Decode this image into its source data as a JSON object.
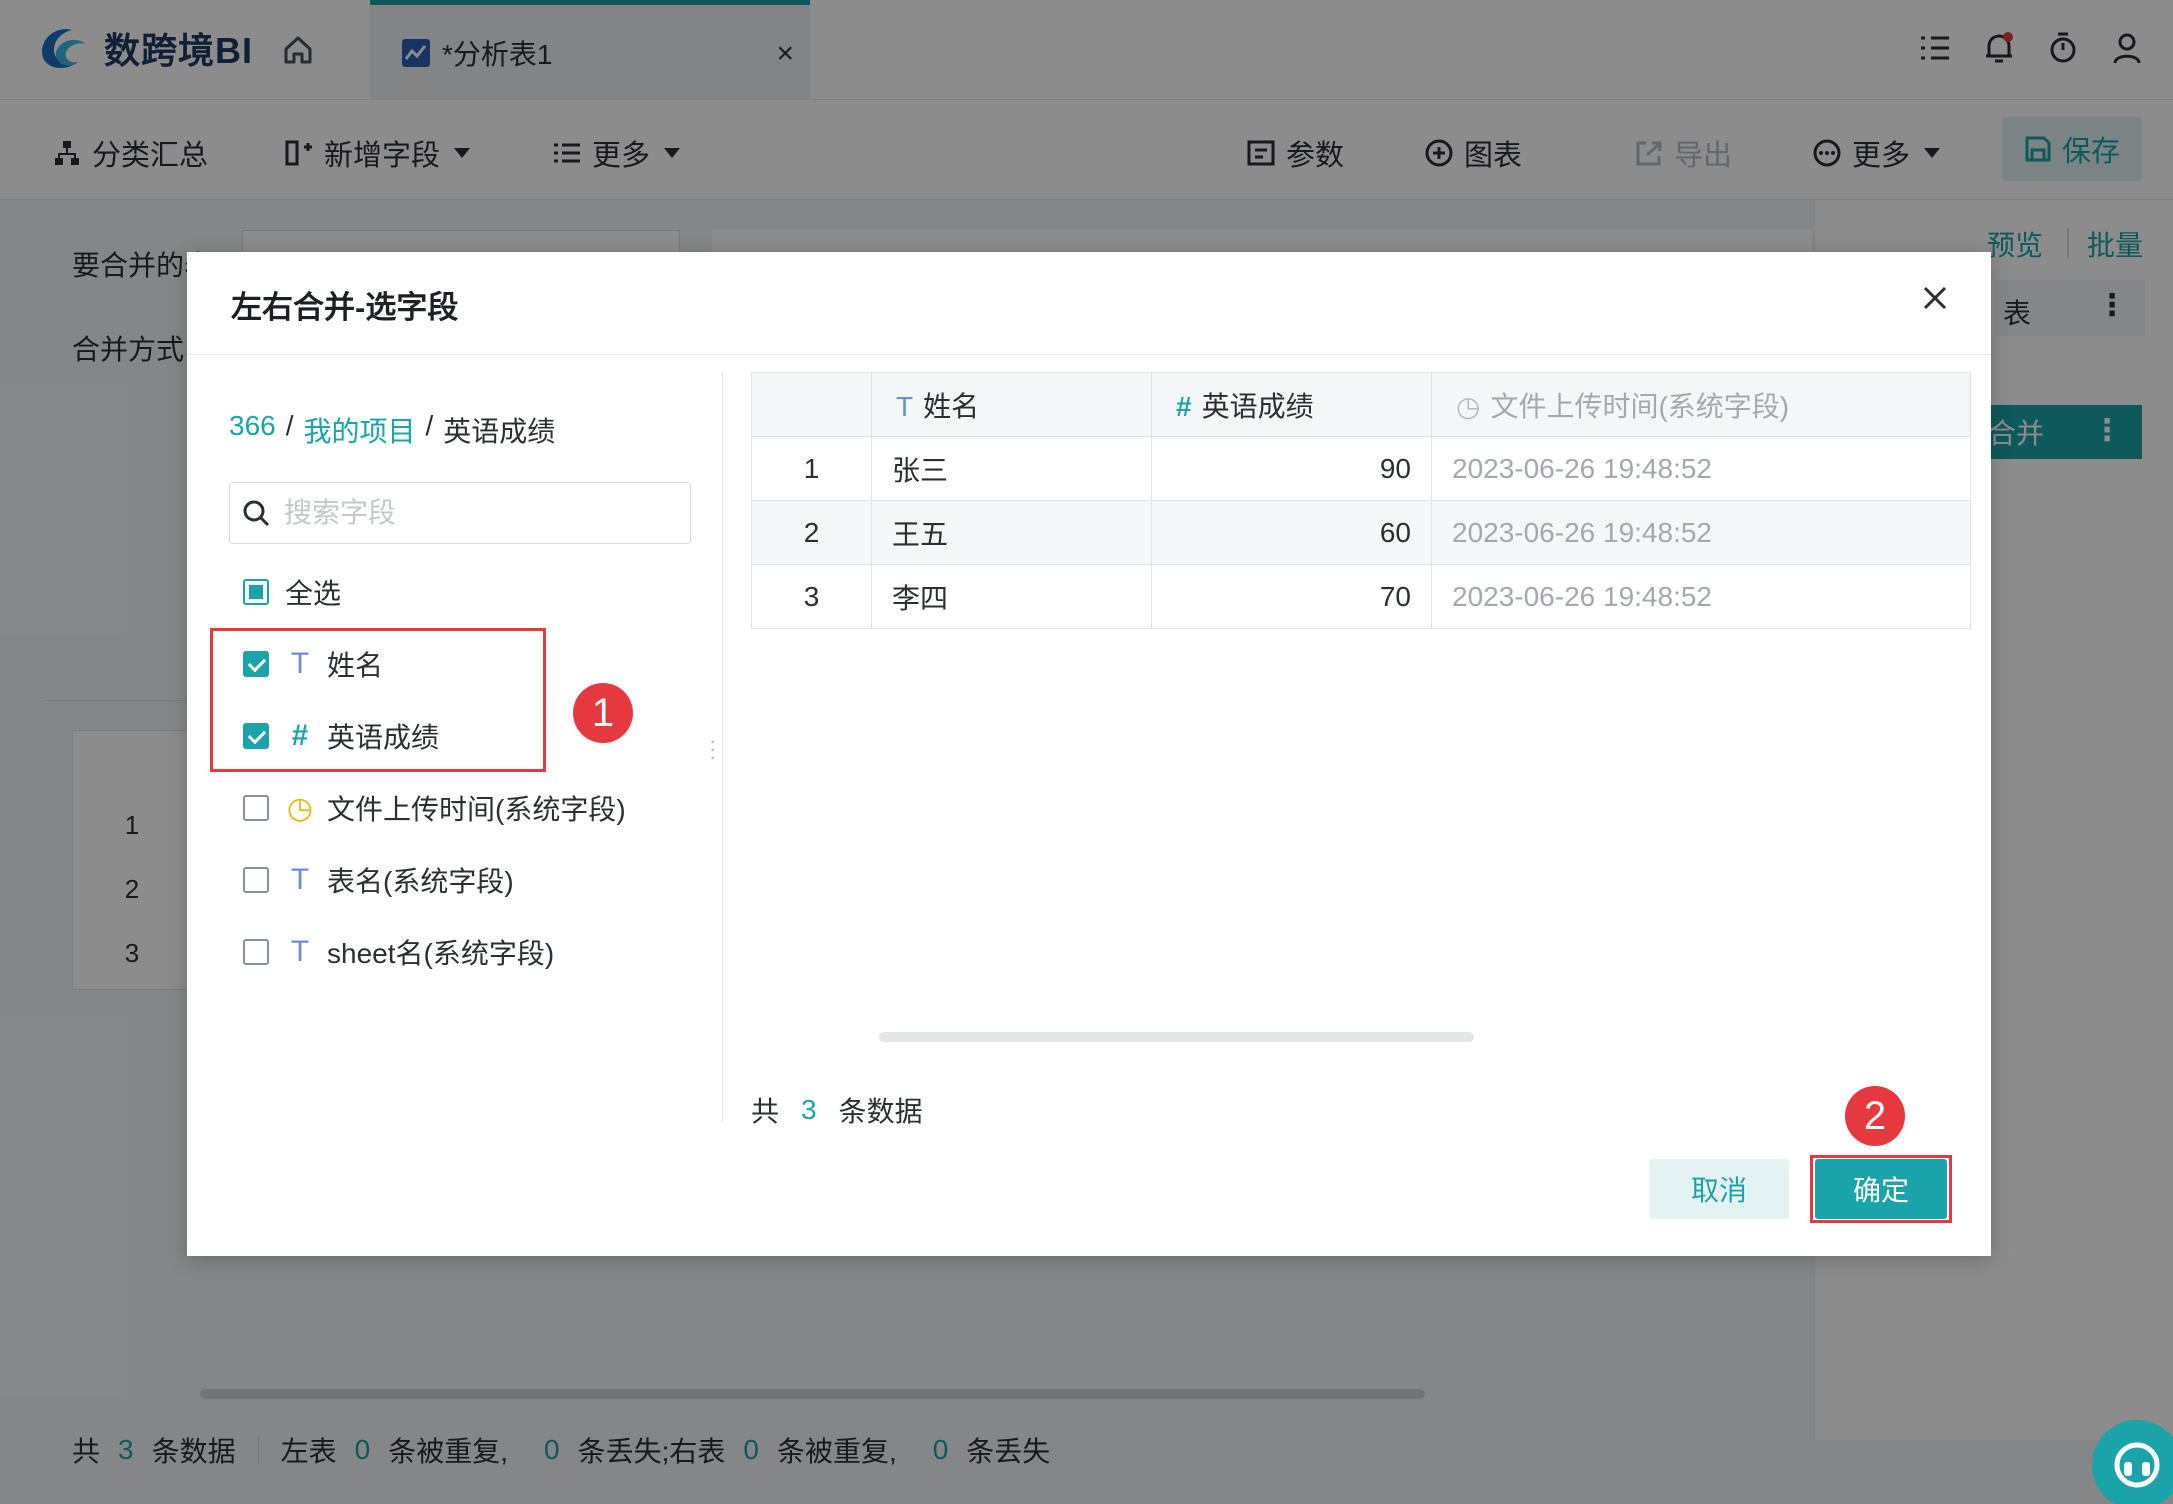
{
  "app": {
    "logo_text": "数跨境BI",
    "tab_title": "*分析表1",
    "tab_close": "×"
  },
  "toolbar": {
    "group_summary": "分类汇总",
    "add_field": "新增字段",
    "more_left": "更多",
    "params": "参数",
    "chart": "图表",
    "export": "导出",
    "more_right": "更多",
    "save": "保存"
  },
  "background": {
    "merge_table_label": "要合并的表",
    "merge_mode_label": "合并方式",
    "preview_link": "预览",
    "batch_link": "批量",
    "table_suffix": "表",
    "merge_button": "合并",
    "row_numbers": [
      "1",
      "2",
      "3"
    ],
    "status": {
      "total_prefix": "共",
      "total_count": "3",
      "total_suffix": "条数据",
      "left_table": "左表",
      "left_dup_count": "0",
      "dup_text": "条被重复,",
      "left_lost_count": "0",
      "lost_text_left": "条丢失;",
      "right_table": "右表",
      "right_dup_count": "0",
      "dup_text_right": "条被重复,",
      "right_lost_count": "0",
      "lost_text_right": "条丢失"
    }
  },
  "dialog": {
    "title": "左右合并-选字段",
    "breadcrumb": {
      "root": "366",
      "sep": "/",
      "project": "我的项目",
      "current": "英语成绩"
    },
    "search_placeholder": "搜索字段",
    "select_all": "全选",
    "fields": [
      {
        "label": "姓名",
        "type": "text",
        "checked": true
      },
      {
        "label": "英语成绩",
        "type": "number",
        "checked": true
      },
      {
        "label": "文件上传时间(系统字段)",
        "type": "datetime",
        "checked": false
      },
      {
        "label": "表名(系统字段)",
        "type": "text",
        "checked": false
      },
      {
        "label": "sheet名(系统字段)",
        "type": "text",
        "checked": false
      }
    ],
    "type_glyphs": {
      "text": "T",
      "number": "#",
      "datetime": "◷"
    },
    "table": {
      "columns": [
        "姓名",
        "英语成绩",
        "文件上传时间(系统字段)"
      ],
      "rows": [
        {
          "idx": "1",
          "name": "张三",
          "score": "90",
          "time": "2023-06-26 19:48:52"
        },
        {
          "idx": "2",
          "name": "王五",
          "score": "60",
          "time": "2023-06-26 19:48:52"
        },
        {
          "idx": "3",
          "name": "李四",
          "score": "70",
          "time": "2023-06-26 19:48:52"
        }
      ]
    },
    "record_count": {
      "prefix": "共",
      "count": "3",
      "suffix": "条数据"
    },
    "cancel": "取消",
    "confirm": "确定",
    "annotations": [
      "1",
      "2"
    ]
  },
  "colors": {
    "accent": "#1aa3a8",
    "annotation": "#e6393f",
    "text_type": "#6a8fd8",
    "date_type": "#f0b400"
  }
}
